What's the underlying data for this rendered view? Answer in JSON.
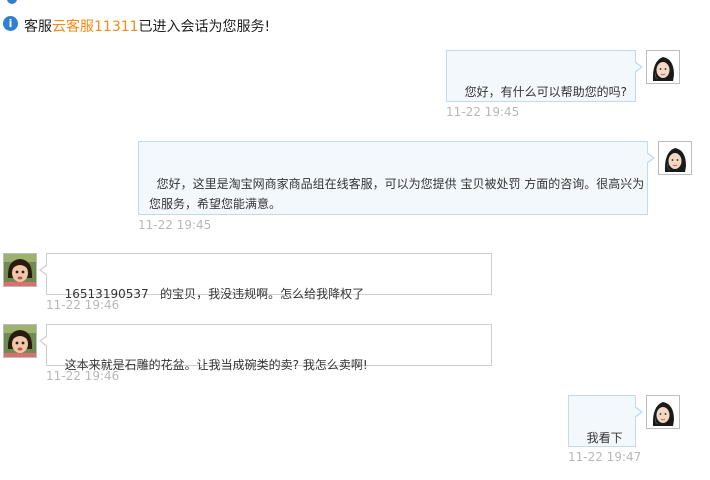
{
  "system": {
    "prefix": "客服",
    "agent_name": "云客服11311",
    "suffix": "已进入会话为您服务!"
  },
  "messages": [
    {
      "side": "agent",
      "text": "您好，有什么可以帮助您的吗?",
      "time": "11-22 19:45"
    },
    {
      "side": "agent",
      "text": "您好，这里是淘宝网商家商品组在线客服，可以为您提供 宝贝被处罚 方面的咨询。很高兴为\n您服务，希望您能满意。",
      "time": "11-22 19:45"
    },
    {
      "side": "user",
      "text": "16513190537   的宝贝，我没违规啊。怎么给我降权了",
      "time": "11-22 19:46"
    },
    {
      "side": "user",
      "text": "这本来就是石雕的花盆。让我当成碗类的卖? 我怎么卖啊!",
      "time": "11-22 19:46"
    },
    {
      "side": "agent",
      "text": "我看下",
      "time": "11-22 19:47"
    }
  ],
  "avatars": {
    "agent": "agent-avatar-photo",
    "user": "user-avatar-photo"
  },
  "icons": {
    "system": "info-icon"
  },
  "colors": {
    "agent_name": "#f08b18",
    "agent_bubble_bg": "#f3f8fd",
    "agent_bubble_border": "#c2d9ef",
    "user_bubble_border": "#cfcfcf",
    "timestamp": "#b8b8b8"
  }
}
